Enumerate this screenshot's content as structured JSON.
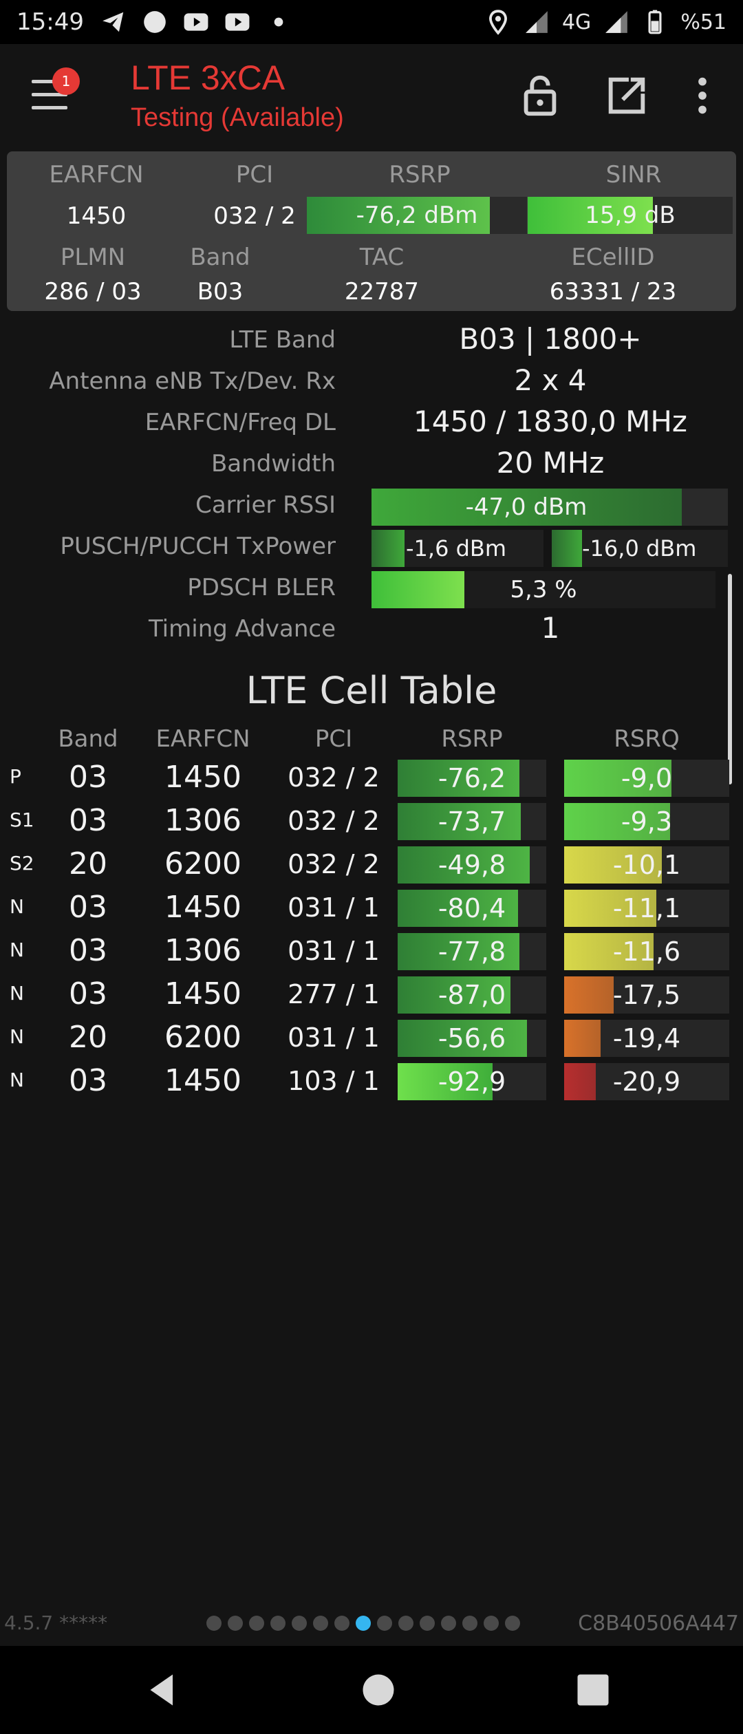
{
  "status_bar": {
    "time": "15:49",
    "network": "4G",
    "battery": "%51",
    "icons_left": [
      "telegram-icon",
      "circle-icon",
      "youtube-icon",
      "youtube-icon",
      "dot-icon"
    ],
    "icons_right": [
      "location-icon",
      "signal-icon",
      "signal-icon",
      "battery-icon"
    ]
  },
  "app_bar": {
    "title": "LTE 3xCA",
    "subtitle": "Testing (Available)",
    "menu_badge": "1",
    "actions": [
      "lock-icon",
      "open-external-icon",
      "more-vert-icon"
    ]
  },
  "summary": {
    "labels": {
      "earfcn": "EARFCN",
      "pci": "PCI",
      "rsrp": "RSRP",
      "sinr": "SINR",
      "plmn": "PLMN",
      "band": "Band",
      "tac": "TAC",
      "ecellid": "ECellID"
    },
    "values": {
      "earfcn": "1450",
      "pci": "032 / 2",
      "rsrp": "-76,2 dBm",
      "sinr": "15,9 dB",
      "plmn": "286 / 03",
      "band": "B03",
      "tac": "22787",
      "ecellid": "63331 / 23"
    },
    "rsrp_level": 0.83,
    "sinr_level": 0.61
  },
  "details": [
    {
      "label": "LTE Band",
      "value": "B03 | 1800+"
    },
    {
      "label": "Antenna eNB Tx/Dev. Rx",
      "value": "2 x 4"
    },
    {
      "label": "EARFCN/Freq DL",
      "value": "1450 / 1830,0 MHz"
    },
    {
      "label": "Bandwidth",
      "value": "20 MHz"
    },
    {
      "label": "Carrier RSSI",
      "value": "-47,0 dBm",
      "level": 0.87
    },
    {
      "label": "PUSCH/PUCCH TxPower",
      "value": "-1,6 dBm",
      "value2": "-16,0 dBm",
      "level": 0.19,
      "level2": 0.17
    },
    {
      "label": "PDSCH BLER",
      "value": "5,3 %",
      "level": 0.27
    },
    {
      "label": "Timing Advance",
      "value": "1"
    }
  ],
  "cell_table": {
    "title": "LTE Cell Table",
    "headers": [
      "Band",
      "EARFCN",
      "PCI",
      "RSRP",
      "RSRQ"
    ],
    "rows": [
      {
        "type": "P",
        "band": "03",
        "earfcn": "1450",
        "pci": "032 / 2",
        "rsrp": "-76,2",
        "rsrq": "-9,0",
        "rsrp_level": 0.82,
        "rsrq_level": 0.65,
        "rsrq_color": "#5fd24a"
      },
      {
        "type": "S1",
        "band": "03",
        "earfcn": "1306",
        "pci": "032 / 2",
        "rsrp": "-73,7",
        "rsrq": "-9,3",
        "rsrp_level": 0.83,
        "rsrq_level": 0.64,
        "rsrq_color": "#5fd24a"
      },
      {
        "type": "S2",
        "band": "20",
        "earfcn": "6200",
        "pci": "032 / 2",
        "rsrp": "-49,8",
        "rsrq": "-10,1",
        "rsrp_level": 0.89,
        "rsrq_level": 0.59,
        "rsrq_color": "#d8d84a"
      },
      {
        "type": "N",
        "band": "03",
        "earfcn": "1450",
        "pci": "031 / 1",
        "rsrp": "-80,4",
        "rsrq": "-11,1",
        "rsrp_level": 0.81,
        "rsrq_level": 0.56,
        "rsrq_color": "#d8d84a"
      },
      {
        "type": "N",
        "band": "03",
        "earfcn": "1306",
        "pci": "031 / 1",
        "rsrp": "-77,8",
        "rsrq": "-11,6",
        "rsrp_level": 0.82,
        "rsrq_level": 0.54,
        "rsrq_color": "#d8d84a"
      },
      {
        "type": "N",
        "band": "03",
        "earfcn": "1450",
        "pci": "277 / 1",
        "rsrp": "-87,0",
        "rsrq": "-17,5",
        "rsrp_level": 0.76,
        "rsrq_level": 0.3,
        "rsrq_color": "#d9722a"
      },
      {
        "type": "N",
        "band": "20",
        "earfcn": "6200",
        "pci": "031 / 1",
        "rsrp": "-56,6",
        "rsrq": "-19,4",
        "rsrp_level": 0.87,
        "rsrq_level": 0.22,
        "rsrq_color": "#d9722a"
      },
      {
        "type": "N",
        "band": "03",
        "earfcn": "1450",
        "pci": "103 / 1",
        "rsrp": "-92,9",
        "rsrq": "-20,9",
        "rsrp_level": 0.64,
        "rsrq_level": 0.19,
        "rsrq_color": "#b82e2e"
      }
    ]
  },
  "footer": {
    "version": "4.5.7 *****",
    "device_id": "C8B40506A447",
    "page_count": 15,
    "active_page": 8
  },
  "nav_bar": [
    "back-icon",
    "home-icon",
    "recents-icon"
  ]
}
